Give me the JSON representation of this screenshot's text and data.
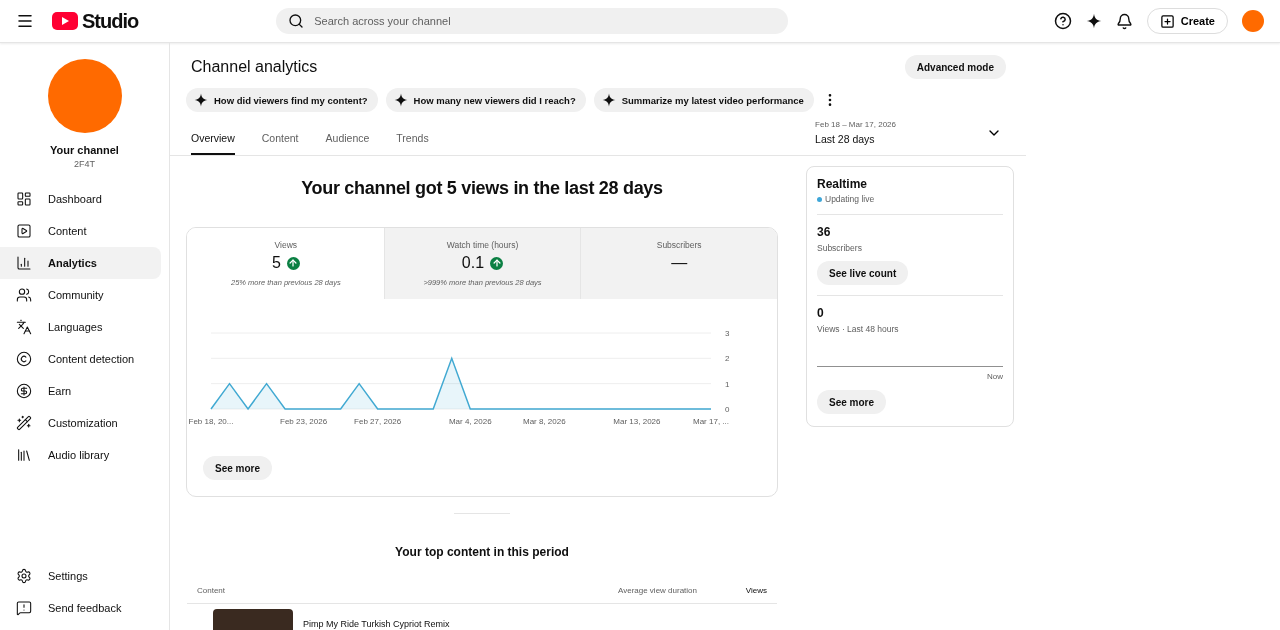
{
  "header": {
    "logo": "Studio",
    "search": {
      "placeholder": "Search across your channel"
    },
    "create_button": "Create"
  },
  "sidebar": {
    "channel_name": "Your channel",
    "channel_handle": "2F4T",
    "items": [
      {
        "label": "Dashboard",
        "kind": "dashboard",
        "selected": false
      },
      {
        "label": "Content",
        "kind": "content",
        "selected": false
      },
      {
        "label": "Analytics",
        "kind": "analytics",
        "selected": true
      },
      {
        "label": "Community",
        "kind": "community",
        "selected": false
      },
      {
        "label": "Languages",
        "kind": "languages",
        "selected": false
      },
      {
        "label": "Content detection",
        "kind": "detection",
        "selected": false
      },
      {
        "label": "Earn",
        "kind": "earn",
        "selected": false
      },
      {
        "label": "Customization",
        "kind": "customization",
        "selected": false
      },
      {
        "label": "Audio library",
        "kind": "audio",
        "selected": false
      }
    ],
    "bottom_items": [
      {
        "label": "Settings",
        "kind": "settings"
      },
      {
        "label": "Send feedback",
        "kind": "feedback"
      }
    ]
  },
  "page": {
    "title": "Channel analytics",
    "advanced_button": "Advanced mode",
    "suggestions": [
      "How did viewers find my content?",
      "How many new viewers did I reach?",
      "Summarize my latest video performance"
    ],
    "tabs": [
      {
        "label": "Overview",
        "selected": true
      },
      {
        "label": "Content",
        "selected": false
      },
      {
        "label": "Audience",
        "selected": false
      },
      {
        "label": "Trends",
        "selected": false
      }
    ],
    "date_range": {
      "dates": "Feb 18 – Mar 17, 2026",
      "label": "Last 28 days"
    },
    "headline": "Your channel got 5 views in the last 28 days",
    "metrics": [
      {
        "label": "Views",
        "value": "5",
        "up": true,
        "note": "25% more than previous 28 days",
        "selected": true
      },
      {
        "label": "Watch time (hours)",
        "value": "0.1",
        "up": true,
        "note": ">999% more than previous 28 days",
        "selected": false
      },
      {
        "label": "Subscribers",
        "value": "—",
        "up": false,
        "selected": false
      }
    ],
    "chart_data": {
      "type": "area",
      "categories": [
        "Feb 18, 20...",
        null,
        null,
        null,
        null,
        "Feb 23, 2026",
        null,
        null,
        null,
        "Feb 27, 2026",
        null,
        null,
        null,
        null,
        "Mar 4, 2026",
        null,
        null,
        null,
        "Mar 8, 2026",
        null,
        null,
        null,
        null,
        "Mar 13, 2026",
        null,
        null,
        null,
        "Mar 17, ..."
      ],
      "series": [
        {
          "color": "#41a9d2",
          "values": [
            0,
            1,
            0,
            1,
            0,
            0,
            0,
            0,
            1,
            0,
            0,
            0,
            0,
            2,
            0,
            0,
            0,
            0,
            0,
            0,
            0,
            0,
            0,
            0,
            0,
            0,
            0,
            0
          ]
        }
      ],
      "ylim": [
        0,
        3
      ],
      "yticks": [
        0,
        1,
        2,
        3
      ]
    },
    "see_more": "See more",
    "top_content": {
      "title": "Your top content in this period",
      "columns": [
        "Content",
        "Average view duration",
        "Views"
      ],
      "rows": [
        {
          "title": "Pimp My Ride Turkish Cypriot Remix"
        }
      ]
    }
  },
  "realtime": {
    "title": "Realtime",
    "status": "Updating live",
    "subscribers": "36",
    "subscribers_label": "Subscribers",
    "live_button": "See live count",
    "views": "0",
    "views_label": "Views · Last 48 hours",
    "axis_label": "Now",
    "see_more": "See more"
  }
}
